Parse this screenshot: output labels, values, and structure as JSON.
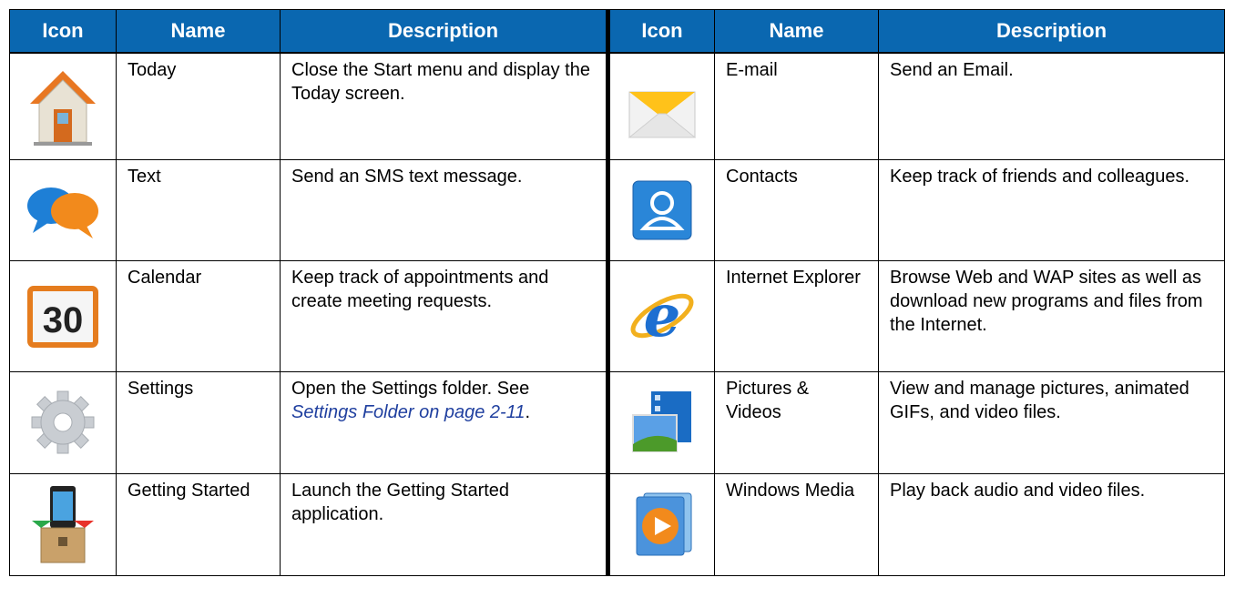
{
  "headers": {
    "icon": "Icon",
    "name": "Name",
    "description": "Description"
  },
  "rows": [
    {
      "left": {
        "icon": "house-icon",
        "name": "Today",
        "description": "Close the Start menu and display the Today screen."
      },
      "right": {
        "icon": "envelope-icon",
        "name": "E-mail",
        "description": "Send an Email."
      }
    },
    {
      "left": {
        "icon": "chat-bubbles-icon",
        "name": "Text",
        "description": "Send an SMS text message."
      },
      "right": {
        "icon": "contact-card-icon",
        "name": "Contacts",
        "description": "Keep track of friends and colleagues."
      }
    },
    {
      "left": {
        "icon": "calendar-icon",
        "icon_text": "30",
        "name": "Calendar",
        "description": "Keep track of appointments and create meeting requests."
      },
      "right": {
        "icon": "internet-explorer-icon",
        "name": "Internet Explorer",
        "description": "Browse Web and WAP sites as well as download new programs and files from the Internet."
      }
    },
    {
      "left": {
        "icon": "gear-icon",
        "name": "Settings",
        "description": "Open the Settings folder.",
        "description_link_prefix": "See ",
        "description_link": "Settings Folder on page 2-11",
        "description_suffix": "."
      },
      "right": {
        "icon": "pictures-videos-icon",
        "name": "Pictures & Videos",
        "description": "View and manage pictures, animated GIFs, and video files."
      }
    },
    {
      "left": {
        "icon": "getting-started-icon",
        "name": "Getting Started",
        "description": "Launch the Getting Started application."
      },
      "right": {
        "icon": "windows-media-icon",
        "name": "Windows Media",
        "description": "Play back audio and video files."
      }
    }
  ]
}
